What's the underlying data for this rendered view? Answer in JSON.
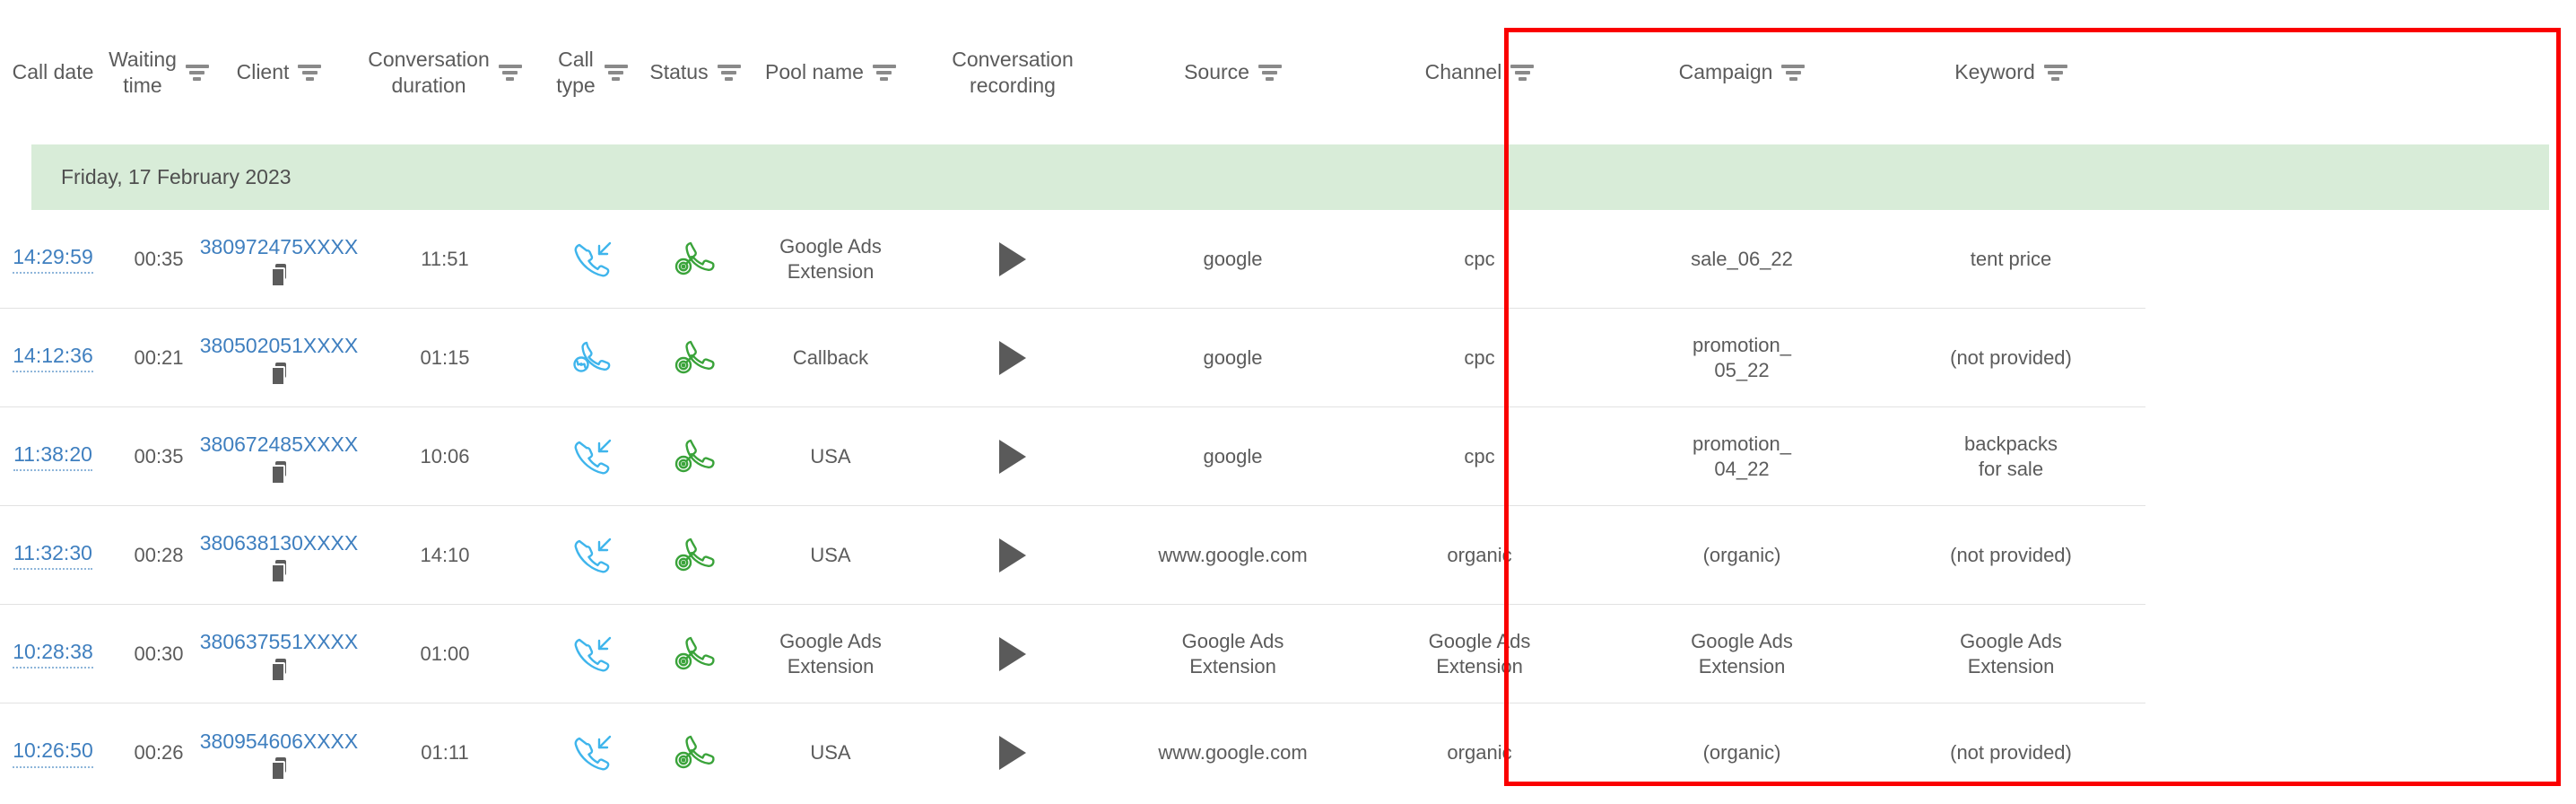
{
  "columns": [
    {
      "key": "call_date",
      "label": "Call date",
      "filter": false
    },
    {
      "key": "waiting_time",
      "label": "Waiting\ntime",
      "filter": true
    },
    {
      "key": "client",
      "label": "Client",
      "filter": true
    },
    {
      "key": "conversation_duration",
      "label": "Conversation\nduration",
      "filter": true
    },
    {
      "key": "call_type",
      "label": "Call\ntype",
      "filter": true
    },
    {
      "key": "status",
      "label": "Status",
      "filter": true
    },
    {
      "key": "pool_name",
      "label": "Pool name",
      "filter": true
    },
    {
      "key": "conversation_recording",
      "label": "Conversation\nrecording",
      "filter": false
    },
    {
      "key": "source",
      "label": "Source",
      "filter": true
    },
    {
      "key": "channel",
      "label": "Channel",
      "filter": true
    },
    {
      "key": "campaign",
      "label": "Campaign",
      "filter": true
    },
    {
      "key": "keyword",
      "label": "Keyword",
      "filter": true
    }
  ],
  "date_group": {
    "label": "Friday, 17 February 2023"
  },
  "rows": [
    {
      "call_date": "14:29:59",
      "waiting_time": "00:35",
      "client": "380972475XXXX",
      "conversation_duration": "11:51",
      "call_type": "incoming-call-icon",
      "status": "target-call-icon",
      "pool_name": "Google Ads\nExtension",
      "conversation_recording": "play-icon",
      "source": "google",
      "channel": "cpc",
      "campaign": "sale_06_22",
      "keyword": "tent price"
    },
    {
      "call_date": "14:12:36",
      "waiting_time": "00:21",
      "client": "380502051XXXX",
      "conversation_duration": "01:15",
      "call_type": "callback-call-icon",
      "status": "target-call-icon",
      "pool_name": "Callback",
      "conversation_recording": "play-icon",
      "source": "google",
      "channel": "cpc",
      "campaign": "promotion_\n05_22",
      "keyword": "(not provided)"
    },
    {
      "call_date": "11:38:20",
      "waiting_time": "00:35",
      "client": "380672485XXXX",
      "conversation_duration": "10:06",
      "call_type": "incoming-call-icon",
      "status": "target-call-icon",
      "pool_name": "USA",
      "conversation_recording": "play-icon",
      "source": "google",
      "channel": "cpc",
      "campaign": "promotion_\n04_22",
      "keyword": "backpacks\nfor sale"
    },
    {
      "call_date": "11:32:30",
      "waiting_time": "00:28",
      "client": "380638130XXXX",
      "conversation_duration": "14:10",
      "call_type": "incoming-call-icon",
      "status": "target-call-icon",
      "pool_name": "USA",
      "conversation_recording": "play-icon",
      "source": "www.google.com",
      "channel": "organic",
      "campaign": "(organic)",
      "keyword": "(not provided)"
    },
    {
      "call_date": "10:28:38",
      "waiting_time": "00:30",
      "client": "380637551XXXX",
      "conversation_duration": "01:00",
      "call_type": "incoming-call-icon",
      "status": "target-call-icon",
      "pool_name": "Google Ads\nExtension",
      "conversation_recording": "play-icon",
      "source": "Google Ads\nExtension",
      "channel": "Google Ads\nExtension",
      "campaign": "Google Ads\nExtension",
      "keyword": "Google Ads\nExtension"
    },
    {
      "call_date": "10:26:50",
      "waiting_time": "00:26",
      "client": "380954606XXXX",
      "conversation_duration": "01:11",
      "call_type": "incoming-call-icon",
      "status": "target-call-icon",
      "pool_name": "USA",
      "conversation_recording": "play-icon",
      "source": "www.google.com",
      "channel": "organic",
      "campaign": "(organic)",
      "keyword": "(not provided)"
    }
  ],
  "annotation": {
    "highlight_color": "#fa0000",
    "highlight_label": "attribution-columns-highlight"
  },
  "colors": {
    "link": "#3f7fbf",
    "text": "#5b5b5b",
    "date_banner_bg": "#d8ecd8",
    "row_border": "#e2e2e2",
    "incoming_icon": "#3fb5ec",
    "status_icon": "#3aa33a",
    "play_icon": "#5a5a5a"
  }
}
